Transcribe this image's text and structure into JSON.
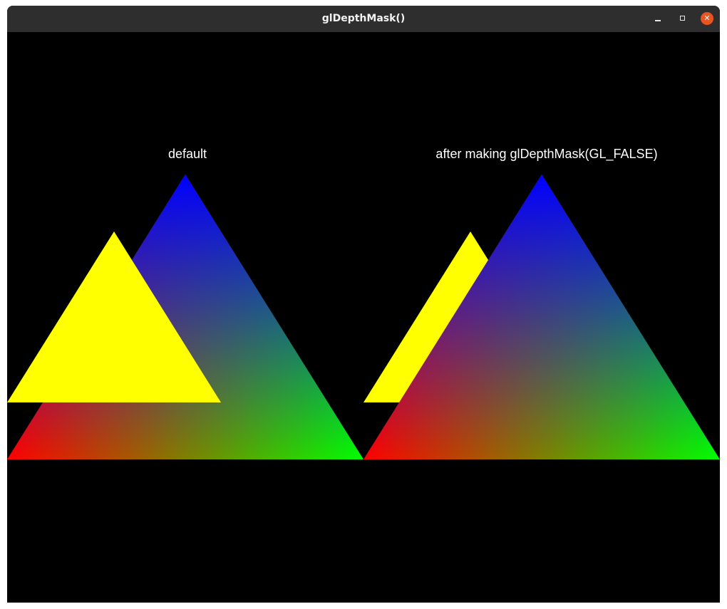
{
  "window": {
    "title": "glDepthMask()",
    "controls": {
      "minimize": "minimize",
      "maximize": "maximize",
      "close": "close"
    }
  },
  "scene": {
    "left_label": "default",
    "right_label": "after making glDepthMask(GL_FALSE)",
    "colors": {
      "background": "#000000",
      "yellow": "#ffff00",
      "red": "#ff0000",
      "green": "#00ff00",
      "blue": "#0000ff",
      "titlebar": "#2e2e2e",
      "close_button": "#e95420"
    }
  }
}
